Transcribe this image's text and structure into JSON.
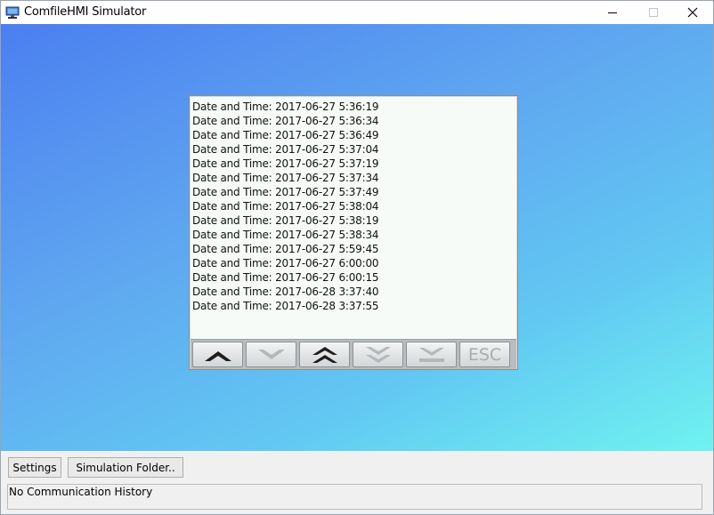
{
  "window": {
    "title": "ComfileHMI Simulator",
    "icon": "monitor-icon"
  },
  "log": {
    "entries": [
      "Date and Time: 2017-06-27 5:36:19",
      "Date and Time: 2017-06-27 5:36:34",
      "Date and Time: 2017-06-27 5:36:49",
      "Date and Time: 2017-06-27 5:37:04",
      "Date and Time: 2017-06-27 5:37:19",
      "Date and Time: 2017-06-27 5:37:34",
      "Date and Time: 2017-06-27 5:37:49",
      "Date and Time: 2017-06-27 5:38:04",
      "Date and Time: 2017-06-27 5:38:19",
      "Date and Time: 2017-06-27 5:38:34",
      "Date and Time: 2017-06-27 5:59:45",
      "Date and Time: 2017-06-27 6:00:00",
      "Date and Time: 2017-06-27 6:00:15",
      "Date and Time: 2017-06-28 3:37:40",
      "Date and Time: 2017-06-28 3:37:55"
    ]
  },
  "nav": {
    "buttons": [
      {
        "icon": "chevron-up-icon",
        "enabled": true
      },
      {
        "icon": "chevron-down-icon",
        "enabled": false
      },
      {
        "icon": "double-chevron-up-icon",
        "enabled": true
      },
      {
        "icon": "double-chevron-down-icon",
        "enabled": false
      },
      {
        "icon": "scroll-to-bottom-icon",
        "enabled": false
      }
    ],
    "esc_label": "ESC"
  },
  "footer": {
    "settings_label": "Settings",
    "folder_label": "Simulation Folder..",
    "status_text": "No Communication History"
  },
  "colors": {
    "background_start": "#4b7ff0",
    "background_end": "#6ff3f0",
    "enabled_icon": "#1e1e1e",
    "disabled_icon": "#b4b8bb"
  }
}
